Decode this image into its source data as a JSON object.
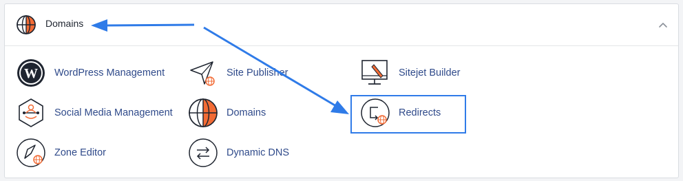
{
  "section": {
    "title": "Domains",
    "collapse_icon": "chevron-up-icon",
    "header_icon": "globe-icon"
  },
  "items": [
    {
      "label": "WordPress Management",
      "icon": "wordpress-icon"
    },
    {
      "label": "Site Publisher",
      "icon": "paper-plane-icon"
    },
    {
      "label": "Sitejet Builder",
      "icon": "monitor-pencil-icon"
    },
    {
      "label": "Social Media Management",
      "icon": "social-media-icon"
    },
    {
      "label": "Domains",
      "icon": "globe-icon"
    },
    {
      "label": "Redirects",
      "icon": "redirect-icon"
    },
    {
      "label": "Zone Editor",
      "icon": "zone-editor-icon"
    },
    {
      "label": "Dynamic DNS",
      "icon": "dynamic-dns-icon"
    }
  ],
  "colors": {
    "accent_orange": "#f26b35",
    "link_blue": "#2f4a8a",
    "annotation_blue": "#2f7be8"
  }
}
